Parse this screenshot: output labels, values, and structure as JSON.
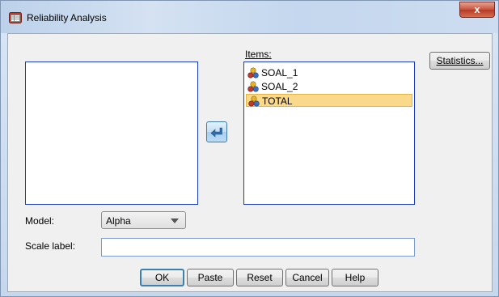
{
  "window": {
    "title": "Reliability Analysis",
    "close_label": "x"
  },
  "items_list": {
    "label": "Items:",
    "items": [
      {
        "name": "SOAL_1",
        "selected": false
      },
      {
        "name": "SOAL_2",
        "selected": false
      },
      {
        "name": "TOTAL",
        "selected": true
      }
    ]
  },
  "buttons": {
    "statistics": "Statistics...",
    "ok": "OK",
    "paste": "Paste",
    "reset": "Reset",
    "cancel": "Cancel",
    "help": "Help"
  },
  "model": {
    "label": "Model:",
    "value": "Alpha"
  },
  "scale_label": {
    "label": "Scale label:",
    "value": ""
  },
  "colors": {
    "selection": "#fbd98a",
    "listbox_border": "#1a3cb8",
    "close_button": "#c8503a"
  }
}
